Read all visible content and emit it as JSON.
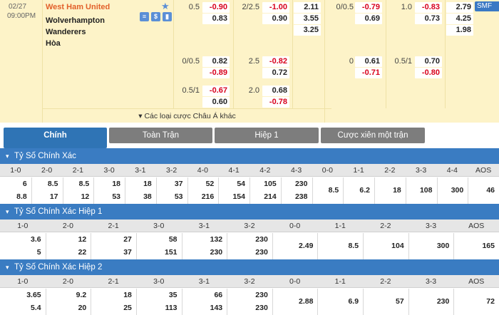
{
  "match": {
    "date": "02/27",
    "time": "09:00PM",
    "home": "West Ham United",
    "away": "Wolverhampton Wanderers",
    "draw": "Hòa",
    "more_label": "▾ Các loại cược Châu Á khác",
    "side_label": "SMF"
  },
  "odds": {
    "ah1": [
      {
        "hc": "0.5",
        "home": "-0.90",
        "away": "0.83"
      },
      {
        "hc": "0/0.5",
        "home": "0.82",
        "away": "-0.89"
      },
      {
        "hc": "0.5/1",
        "home": "-0.67",
        "away": "0.60"
      }
    ],
    "ou1": [
      {
        "line": "2/2.5",
        "over": "-1.00",
        "under": "0.90"
      },
      {
        "line": "2.5",
        "over": "-0.82",
        "under": "0.72"
      },
      {
        "line": "2.0",
        "over": "0.68",
        "under": "-0.78"
      }
    ],
    "x12_1": [
      "2.11",
      "3.55",
      "3.25"
    ],
    "ah2": [
      {
        "hc": "0/0.5",
        "home": "-0.79",
        "away": "0.69"
      },
      {
        "hc": "0",
        "home": "0.61",
        "away": "-0.71"
      }
    ],
    "ou2": [
      {
        "line": "1.0",
        "over": "-0.83",
        "under": "0.73"
      },
      {
        "line": "0.5/1",
        "over": "0.70",
        "under": "-0.80"
      }
    ],
    "x12_2": [
      "2.79",
      "4.25",
      "1.98"
    ]
  },
  "tabs": [
    "Chính",
    "Toàn Trận",
    "Hiệp 1",
    "Cược xiên một trận"
  ],
  "sections": [
    {
      "title": "Tỷ Số Chính Xác",
      "headers": [
        "1-0",
        "2-0",
        "2-1",
        "3-0",
        "3-1",
        "3-2",
        "4-0",
        "4-1",
        "4-2",
        "4-3",
        "0-0",
        "1-1",
        "2-2",
        "3-3",
        "4-4",
        "AOS"
      ],
      "top": [
        "6",
        "8.5",
        "8.5",
        "18",
        "18",
        "37",
        "52",
        "54",
        "105",
        "230",
        "8.5",
        "6.2",
        "18",
        "108",
        "300",
        "46"
      ],
      "bottom": [
        "8.8",
        "17",
        "12",
        "53",
        "38",
        "53",
        "216",
        "154",
        "214",
        "238",
        "",
        "",
        "",
        "",
        "",
        ""
      ]
    },
    {
      "title": "Tỷ Số Chính Xác Hiệp 1",
      "headers": [
        "1-0",
        "2-0",
        "2-1",
        "3-0",
        "3-1",
        "3-2",
        "0-0",
        "1-1",
        "2-2",
        "3-3",
        "AOS"
      ],
      "top": [
        "3.6",
        "12",
        "27",
        "58",
        "132",
        "230",
        "2.49",
        "8.5",
        "104",
        "300",
        "165"
      ],
      "bottom": [
        "5",
        "22",
        "37",
        "151",
        "230",
        "230",
        "",
        "",
        "",
        "",
        ""
      ]
    },
    {
      "title": "Tỷ Số Chính Xác Hiệp 2",
      "headers": [
        "1-0",
        "2-0",
        "2-1",
        "3-0",
        "3-1",
        "3-2",
        "0-0",
        "1-1",
        "2-2",
        "3-3",
        "AOS"
      ],
      "top": [
        "3.65",
        "9.2",
        "18",
        "35",
        "66",
        "230",
        "2.88",
        "6.9",
        "57",
        "230",
        "72"
      ],
      "bottom": [
        "5.4",
        "20",
        "25",
        "113",
        "143",
        "230",
        "",
        "",
        "",
        "",
        ""
      ]
    }
  ],
  "colors": {
    "accent": "#3a7cc2",
    "negative": "#d8001c",
    "home": "#e2602a",
    "odds_bg": "#fdf3c8"
  }
}
